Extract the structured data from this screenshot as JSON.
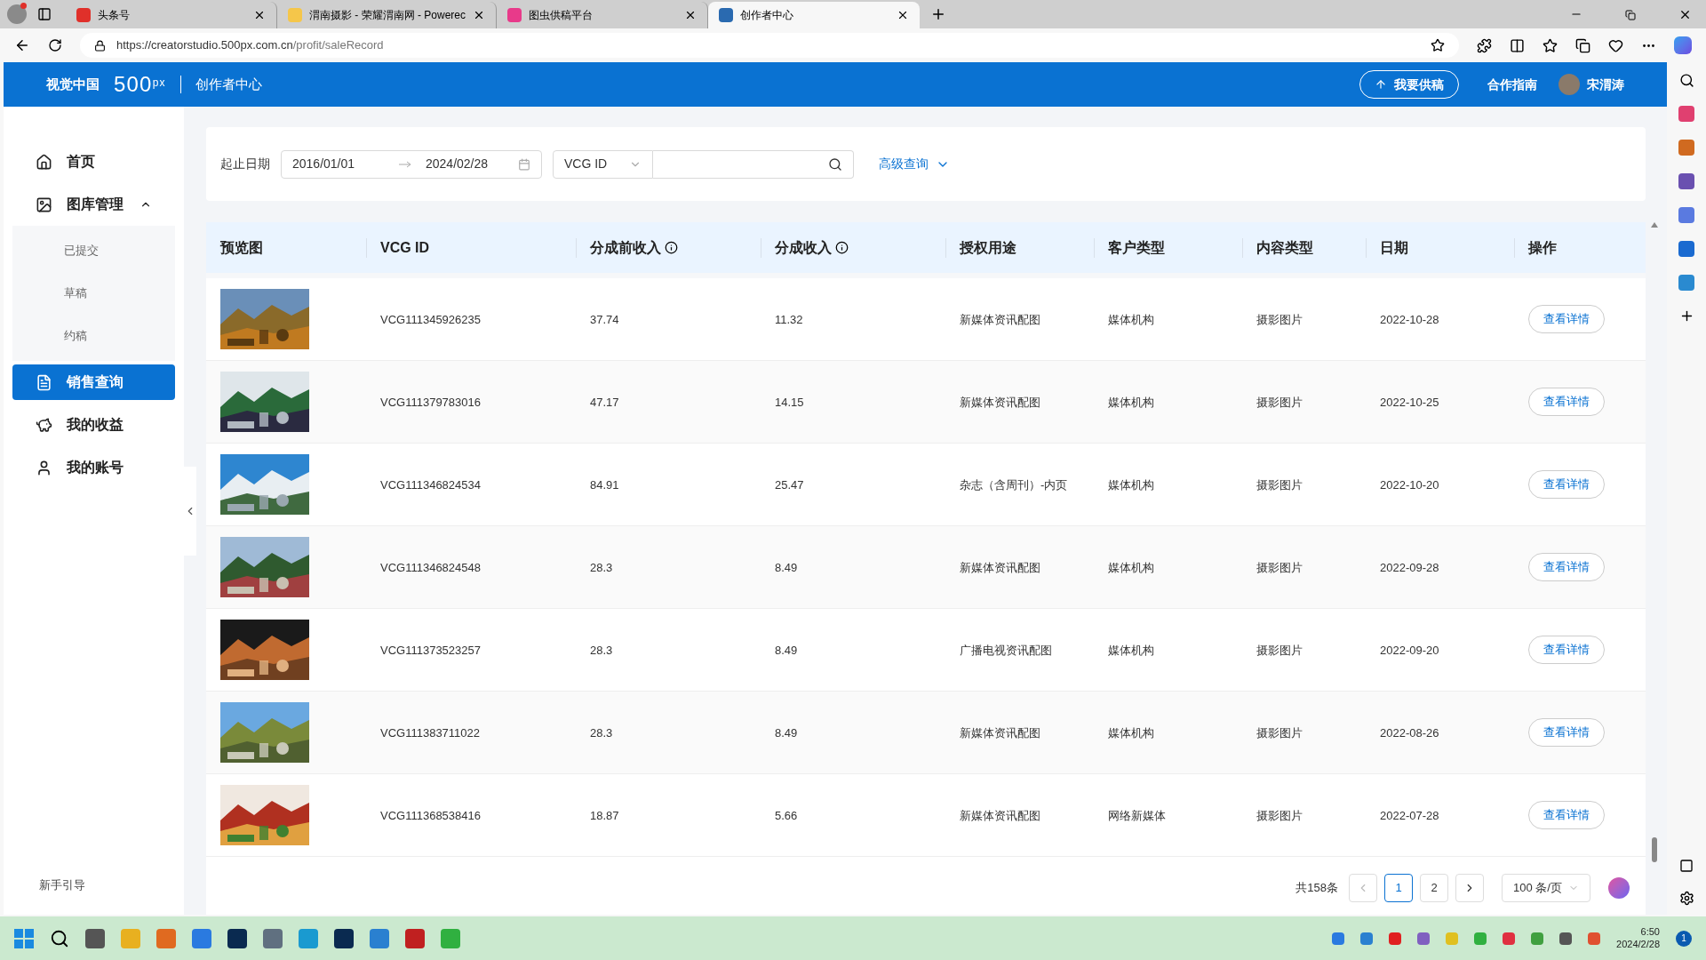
{
  "browser": {
    "tabs": [
      {
        "title": "头条号",
        "selected": false
      },
      {
        "title": "渭南摄影 - 荣耀渭南网 - Powerec",
        "selected": false
      },
      {
        "title": "图虫供稿平台",
        "selected": false
      },
      {
        "title": "创作者中心",
        "selected": true
      }
    ],
    "url_host": "https://creatorstudio.500px.com.cn",
    "url_path": "/profit/saleRecord"
  },
  "header": {
    "brand": "视觉中国",
    "logo": "500$^{px}$",
    "section": "创作者中心",
    "upload_button": "我要供稿",
    "guide_link": "合作指南",
    "user": "宋渭涛"
  },
  "sidebar": {
    "items": [
      {
        "label": "首页",
        "kind": "home",
        "selected": false
      },
      {
        "label": "图库管理",
        "kind": "gallery",
        "selected": false,
        "expanded": true,
        "children": [
          {
            "label": "已提交",
            "selected": false
          },
          {
            "label": "草稿",
            "selected": false
          },
          {
            "label": "约稿",
            "selected": false
          }
        ]
      },
      {
        "label": "销售查询",
        "kind": "sales",
        "selected": true
      },
      {
        "label": "我的收益",
        "kind": "earnings",
        "selected": false
      },
      {
        "label": "我的账号",
        "kind": "account",
        "selected": false
      }
    ],
    "guide": "新手引导"
  },
  "filter": {
    "date_label": "起止日期",
    "start_date": "2016/01/01",
    "end_date": "2024/02/28",
    "id_type": "VCG ID",
    "advanced": "高级查询"
  },
  "table": {
    "columns": [
      {
        "label": "预览图",
        "info": false
      },
      {
        "label": "VCG ID",
        "info": false
      },
      {
        "label": "分成前收入",
        "info": true
      },
      {
        "label": "分成收入",
        "info": true
      },
      {
        "label": "授权用途",
        "info": false
      },
      {
        "label": "客户类型",
        "info": false
      },
      {
        "label": "内容类型",
        "info": false
      },
      {
        "label": "日期",
        "info": false
      },
      {
        "label": "操作",
        "info": false
      }
    ],
    "rows": [
      {
        "id": "VCG111345926235",
        "gross": "37.74",
        "share": "11.32",
        "usage": "新媒体资讯配图",
        "customer": "媒体机构",
        "content": "摄影图片",
        "date": "2022-10-28",
        "action": "查看详情"
      },
      {
        "id": "VCG111379783016",
        "gross": "47.17",
        "share": "14.15",
        "usage": "新媒体资讯配图",
        "customer": "媒体机构",
        "content": "摄影图片",
        "date": "2022-10-25",
        "action": "查看详情"
      },
      {
        "id": "VCG111346824534",
        "gross": "84.91",
        "share": "25.47",
        "usage": "杂志（含周刊）-内页",
        "customer": "媒体机构",
        "content": "摄影图片",
        "date": "2022-10-20",
        "action": "查看详情"
      },
      {
        "id": "VCG111346824548",
        "gross": "28.3",
        "share": "8.49",
        "usage": "新媒体资讯配图",
        "customer": "媒体机构",
        "content": "摄影图片",
        "date": "2022-09-28",
        "action": "查看详情"
      },
      {
        "id": "VCG111373523257",
        "gross": "28.3",
        "share": "8.49",
        "usage": "广播电视资讯配图",
        "customer": "媒体机构",
        "content": "摄影图片",
        "date": "2022-09-20",
        "action": "查看详情"
      },
      {
        "id": "VCG111383711022",
        "gross": "28.3",
        "share": "8.49",
        "usage": "新媒体资讯配图",
        "customer": "媒体机构",
        "content": "摄影图片",
        "date": "2022-08-26",
        "action": "查看详情"
      },
      {
        "id": "VCG111368538416",
        "gross": "18.87",
        "share": "5.66",
        "usage": "新媒体资讯配图",
        "customer": "网络新媒体",
        "content": "摄影图片",
        "date": "2022-07-28",
        "action": "查看详情"
      }
    ]
  },
  "pagination": {
    "total": "共158条",
    "pages": [
      {
        "label": "1",
        "selected": true
      },
      {
        "label": "2",
        "selected": false
      }
    ],
    "page_size": "100 条/页"
  },
  "taskbar": {
    "time": "6:50",
    "date": "2024/2/28",
    "notifications": "1"
  }
}
